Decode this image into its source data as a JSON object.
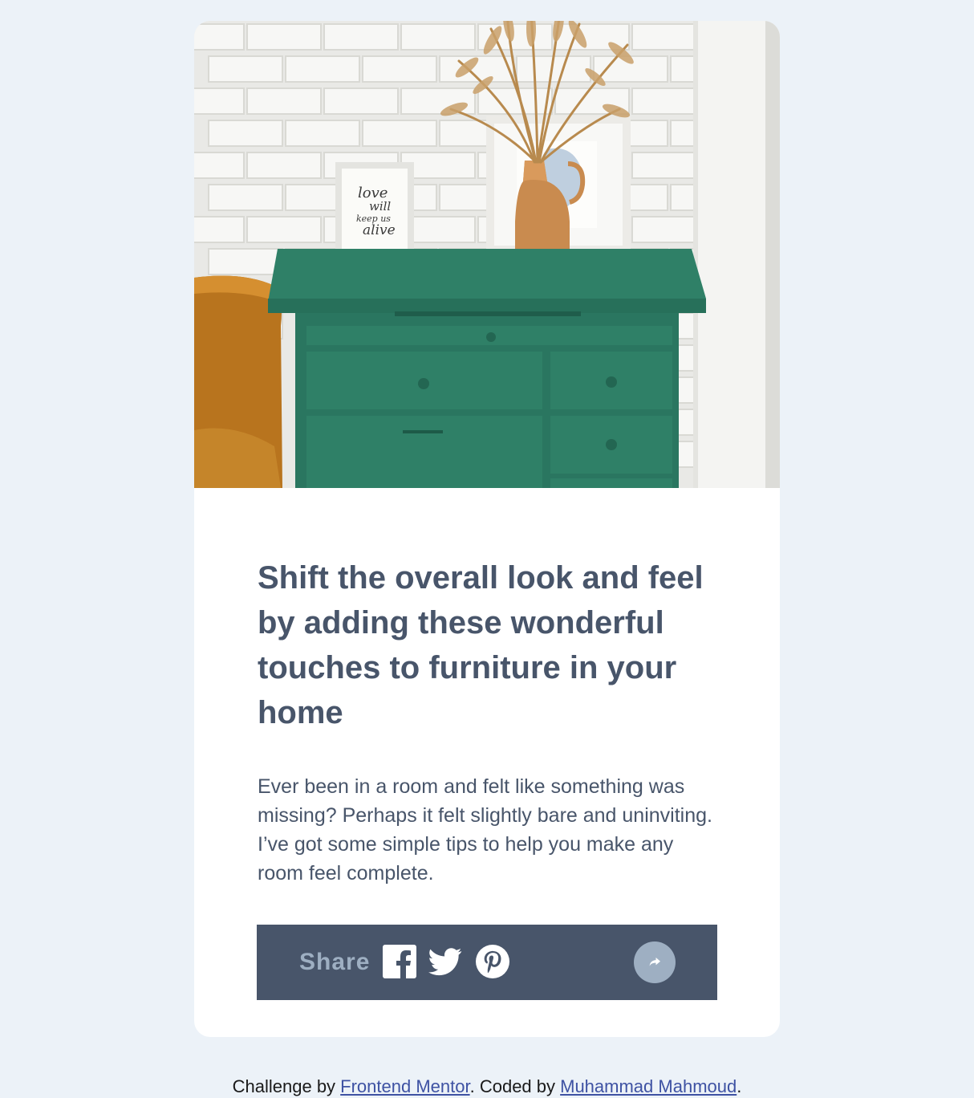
{
  "article": {
    "photo_alt": "drawers",
    "frame_lines": [
      "love",
      "will",
      "keep us",
      "alive"
    ],
    "headline": "Shift the overall look and feel by adding these wonderful touches to furniture in your home",
    "excerpt": "Ever been in a room and felt like something was missing? Perhaps it felt slightly bare and uninviting. I’ve got some simple tips to help you make any room feel complete."
  },
  "share": {
    "label": "Share",
    "icons": [
      "facebook-icon",
      "twitter-icon",
      "pinterest-icon",
      "share-arrow-icon"
    ]
  },
  "attribution": {
    "prefix": "Challenge by ",
    "link1": "Frontend Mentor",
    "middle": ". Coded by ",
    "link2": "Muhammad Mahmoud",
    "suffix": "."
  },
  "colors": {
    "page_bg": "#ecf2f8",
    "card_bg": "#ffffff",
    "text": "#48556a",
    "share_bar": "#48556a",
    "share_label": "#9eafc2",
    "share_button": "#9eafc2",
    "link": "#3e52a3",
    "dresser": "#2d7a62"
  }
}
